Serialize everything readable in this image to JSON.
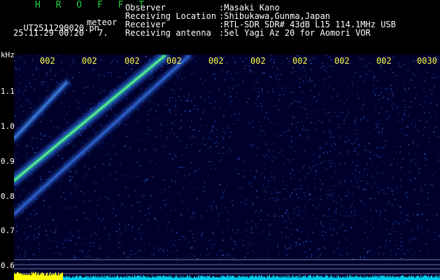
{
  "app": {
    "title": "H R O F F T"
  },
  "file": {
    "name": "UT2511290020.pn",
    "suffix": "meteor"
  },
  "datetime": {
    "date_time": "25.11.29 00:20",
    "index": "7."
  },
  "meta": [
    {
      "label": "Observer",
      "value": ":Masaki Kano"
    },
    {
      "label": "Receiving Location",
      "value": ":Shibukawa,Gunma,Japan"
    },
    {
      "label": "Receiver",
      "value": ":RTL-SDR SDR# 43dB L15 114.1MHz USB"
    },
    {
      "label": "Receiving antenna",
      "value": ":5el Yagi Az 20 for Aomori VOR"
    }
  ],
  "time_axis": [
    "002",
    "002",
    "002",
    "002",
    "002",
    "002",
    "002",
    "002",
    "002",
    "0030"
  ],
  "freq_axis": {
    "unit": "kHz",
    "labels": [
      "1.1",
      "1.0",
      "0.9",
      "0.8",
      "0.7",
      "0.6"
    ]
  },
  "colors": {
    "background": "#000000",
    "spectrogram": "#00002a",
    "title": "#22cc44",
    "time_labels": "#ffff44",
    "signal_strong": "#66ff88",
    "signal_weak": "#3377ff",
    "level_bar": "#ffff00",
    "noise_bar": "#00ccee"
  }
}
